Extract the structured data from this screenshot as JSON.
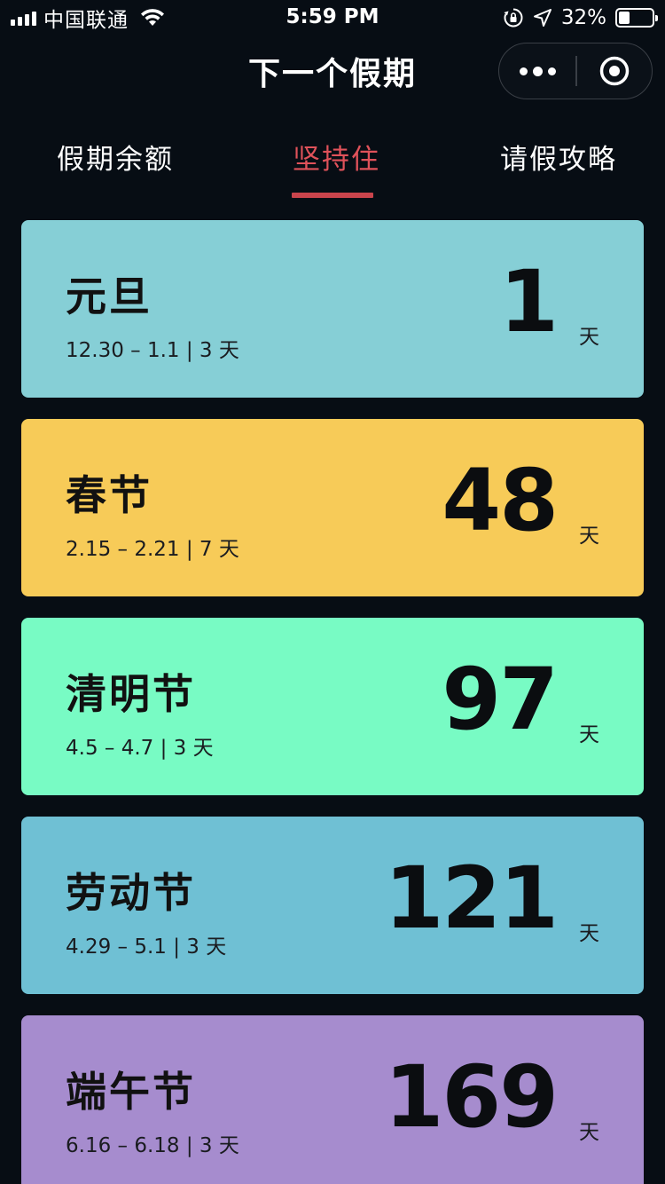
{
  "status_bar": {
    "carrier": "中国联通",
    "time": "5:59 PM",
    "battery_percent": "32%",
    "battery_level": 0.32,
    "icons": [
      "signal-icon",
      "wifi-icon",
      "rotation-lock-icon",
      "location-arrow-icon",
      "battery-icon"
    ]
  },
  "nav": {
    "title": "下一个假期",
    "capsule_icons": [
      "more-icon",
      "close-target-icon"
    ]
  },
  "tabs": [
    {
      "label": "假期余额",
      "active": false
    },
    {
      "label": "坚持住",
      "active": true
    },
    {
      "label": "请假攻略",
      "active": false
    }
  ],
  "colors": {
    "background": "#070d14",
    "active_tab": "#e0525a",
    "tab_underline": "#c9444c"
  },
  "holidays": [
    {
      "name": "元旦",
      "dates": "12.30 – 1.1 | 3 天",
      "days": "1",
      "unit": "天",
      "color": "#86cfd6"
    },
    {
      "name": "春节",
      "dates": "2.15 – 2.21 | 7 天",
      "days": "48",
      "unit": "天",
      "color": "#f7cb58"
    },
    {
      "name": "清明节",
      "dates": "4.5 – 4.7 | 3 天",
      "days": "97",
      "unit": "天",
      "color": "#78fbc4"
    },
    {
      "name": "劳动节",
      "dates": "4.29 – 5.1 | 3 天",
      "days": "121",
      "unit": "天",
      "color": "#6fc0d4"
    },
    {
      "name": "端午节",
      "dates": "6.16 – 6.18 | 3 天",
      "days": "169",
      "unit": "天",
      "color": "#a68cce"
    }
  ]
}
